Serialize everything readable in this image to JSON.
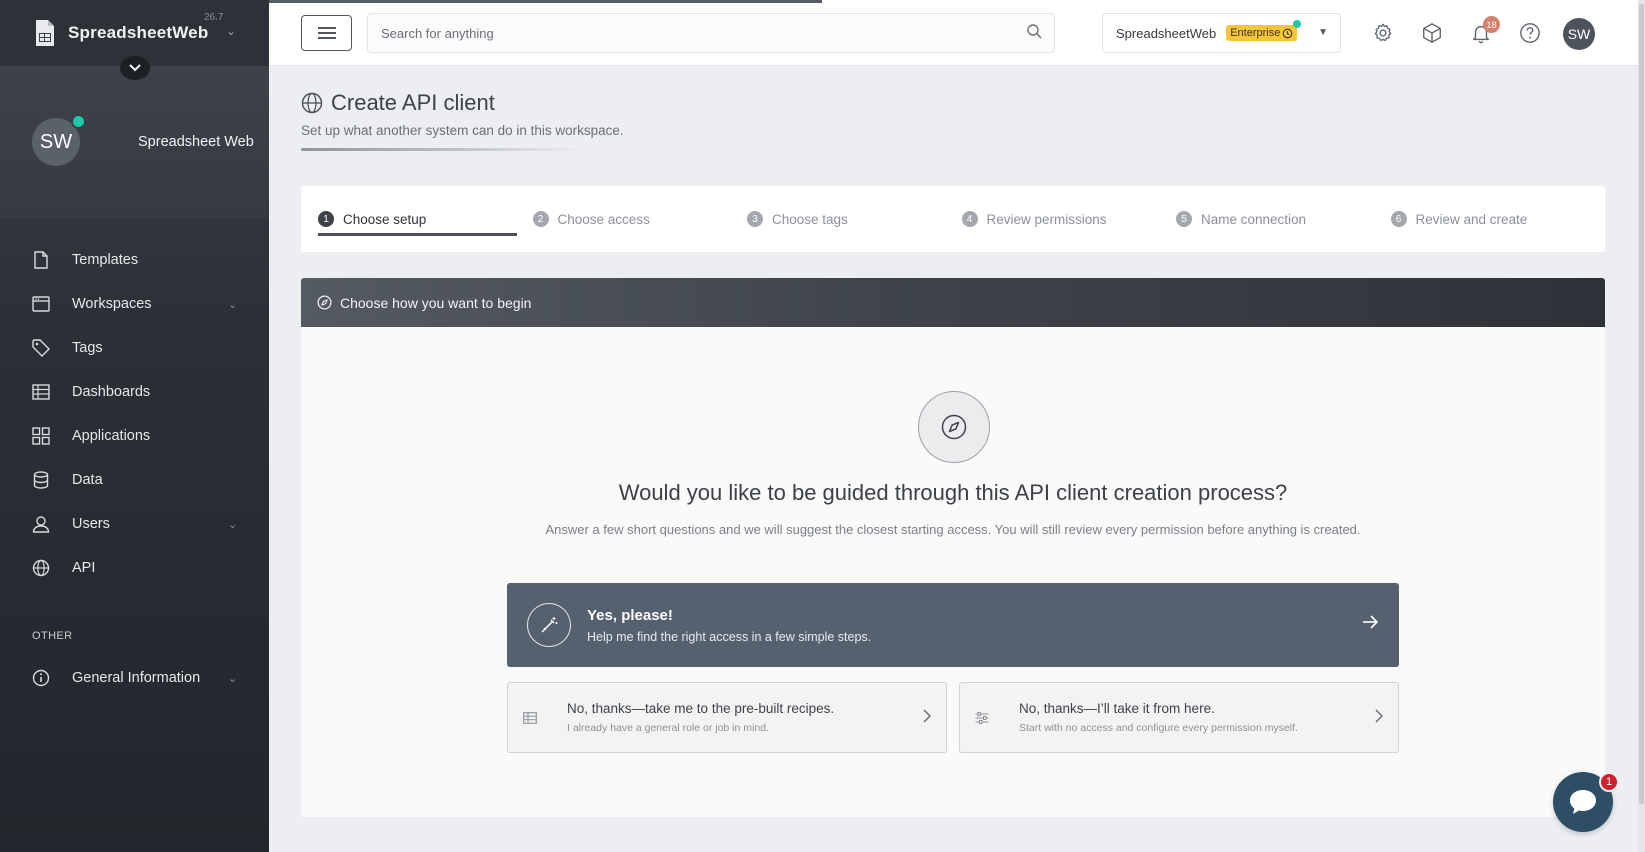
{
  "brand": {
    "name": "SpreadsheetWeb",
    "version": "26.7"
  },
  "profile": {
    "initials": "SW",
    "name": "Spreadsheet Web"
  },
  "nav": {
    "items": [
      {
        "label": "Templates",
        "icon": "file-icon",
        "caret": false
      },
      {
        "label": "Workspaces",
        "icon": "window-icon",
        "caret": true
      },
      {
        "label": "Tags",
        "icon": "tag-icon",
        "caret": false
      },
      {
        "label": "Dashboards",
        "icon": "table-icon",
        "caret": false
      },
      {
        "label": "Applications",
        "icon": "grid-icon",
        "caret": false
      },
      {
        "label": "Data",
        "icon": "database-icon",
        "caret": false
      },
      {
        "label": "Users",
        "icon": "user-icon",
        "caret": true
      },
      {
        "label": "API",
        "icon": "globe-icon",
        "caret": false
      }
    ],
    "other_label": "OTHER",
    "other_items": [
      {
        "label": "General Information",
        "icon": "info-icon",
        "caret": true
      }
    ]
  },
  "topbar": {
    "search_placeholder": "Search for anything",
    "workspace": "SpreadsheetWeb",
    "plan": "Enterprise",
    "notifications": "18",
    "user_initials": "SW"
  },
  "page": {
    "title": "Create API client",
    "subtitle": "Set up what another system can do in this workspace."
  },
  "steps": [
    {
      "num": "1",
      "label": "Choose setup",
      "active": true
    },
    {
      "num": "2",
      "label": "Choose access",
      "active": false
    },
    {
      "num": "3",
      "label": "Choose tags",
      "active": false
    },
    {
      "num": "4",
      "label": "Review permissions",
      "active": false
    },
    {
      "num": "5",
      "label": "Name connection",
      "active": false
    },
    {
      "num": "6",
      "label": "Review and create",
      "active": false
    }
  ],
  "card": {
    "header": "Choose how you want to begin",
    "question": "Would you like to be guided through this API client creation process?",
    "description": "Answer a few short questions and we will suggest the closest starting access. You will still review every permission before anything is created.",
    "primary": {
      "title": "Yes, please!",
      "subtitle": "Help me find the right access in a few simple steps."
    },
    "alt1": {
      "title": "No, thanks—take me to the pre-built recipes.",
      "subtitle": "I already have a general role or job in mind."
    },
    "alt2": {
      "title": "No, thanks—I’ll take it from here.",
      "subtitle": "Start with no access and configure every permission myself."
    }
  },
  "chat": {
    "badge": "1"
  },
  "colors": {
    "sidebar": "#2b2f36",
    "accent": "#566170",
    "badge": "#f7c53c",
    "online": "#20c9a6"
  }
}
